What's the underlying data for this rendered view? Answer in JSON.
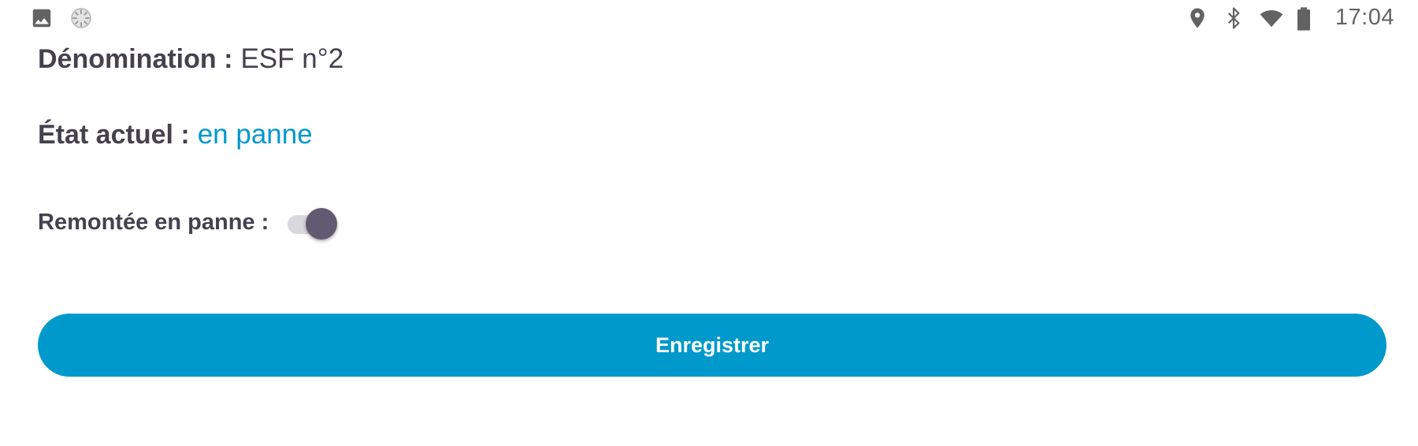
{
  "status_bar": {
    "time": "17:04",
    "left_icons": [
      "image-icon",
      "loading-icon"
    ],
    "right_icons": [
      "location-icon",
      "bluetooth-icon",
      "wifi-icon",
      "battery-icon"
    ],
    "icon_color": "#636363"
  },
  "form": {
    "denomination": {
      "label": "Dénomination :",
      "value": "ESF n°2"
    },
    "etat": {
      "label": "État actuel :",
      "value": "en panne",
      "value_color": "#0099cc"
    },
    "remontee": {
      "label": "Remontée en panne :",
      "checked": true
    }
  },
  "save_button": {
    "label": "Enregistrer",
    "color": "#0099cc"
  }
}
